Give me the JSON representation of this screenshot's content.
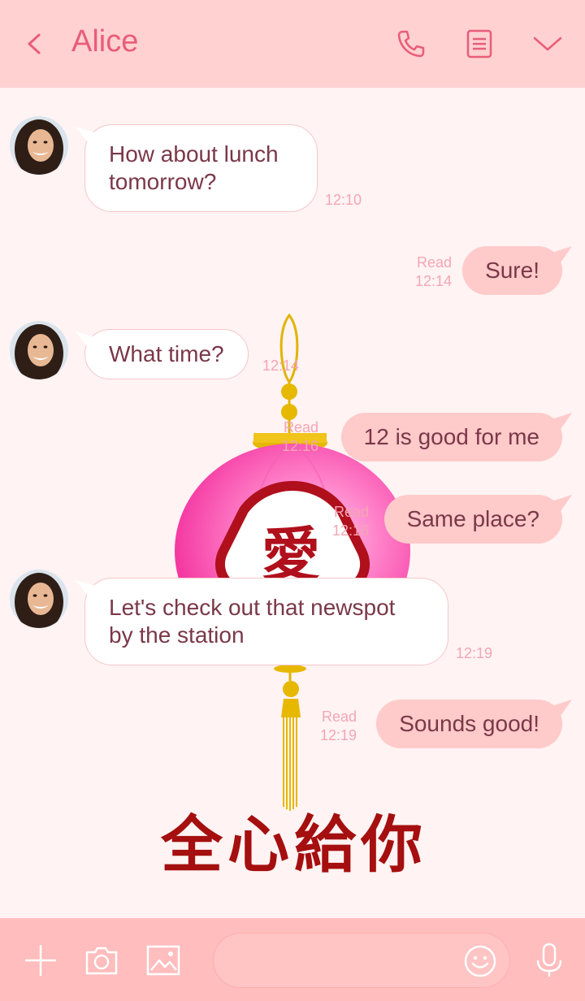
{
  "header": {
    "title": "Alice"
  },
  "messages": [
    {
      "direction": "in",
      "text": "How about lunch tomorrow?",
      "time": "12:10"
    },
    {
      "direction": "out",
      "text": "Sure!",
      "read": "Read",
      "time": "12:14"
    },
    {
      "direction": "in",
      "text": "What time?",
      "time": "12:14"
    },
    {
      "direction": "out",
      "text": "12 is good for me",
      "read": "Read",
      "time": "12:16"
    },
    {
      "direction": "out",
      "text": "Same place?",
      "read": "Read",
      "time": "12:16"
    },
    {
      "direction": "in",
      "text": "Let's check out that newspot by the station",
      "time": "12:19"
    },
    {
      "direction": "out",
      "text": "Sounds good!",
      "read": "Read",
      "time": "12:19"
    }
  ],
  "background": {
    "lantern_character": "愛",
    "slogan": "全心給你"
  },
  "colors": {
    "header_bg": "#ffd1d1",
    "accent": "#e85d78",
    "chat_bg": "#fff3f3",
    "outgoing_bubble": "#ffcaca",
    "incoming_bubble": "#ffffff",
    "message_text": "#7a3848",
    "timestamp": "#f3a6b4",
    "input_bar_bg": "#ffbdbd",
    "lantern": "#ff5fb8",
    "slogan": "#a50f0f"
  },
  "icons": {
    "back": "chevron-left-icon",
    "call": "phone-icon",
    "notes": "notes-icon",
    "menu": "chevron-down-icon",
    "add": "plus-icon",
    "camera": "camera-icon",
    "image": "image-icon",
    "emoji": "emoji-icon",
    "voice": "microphone-icon"
  }
}
